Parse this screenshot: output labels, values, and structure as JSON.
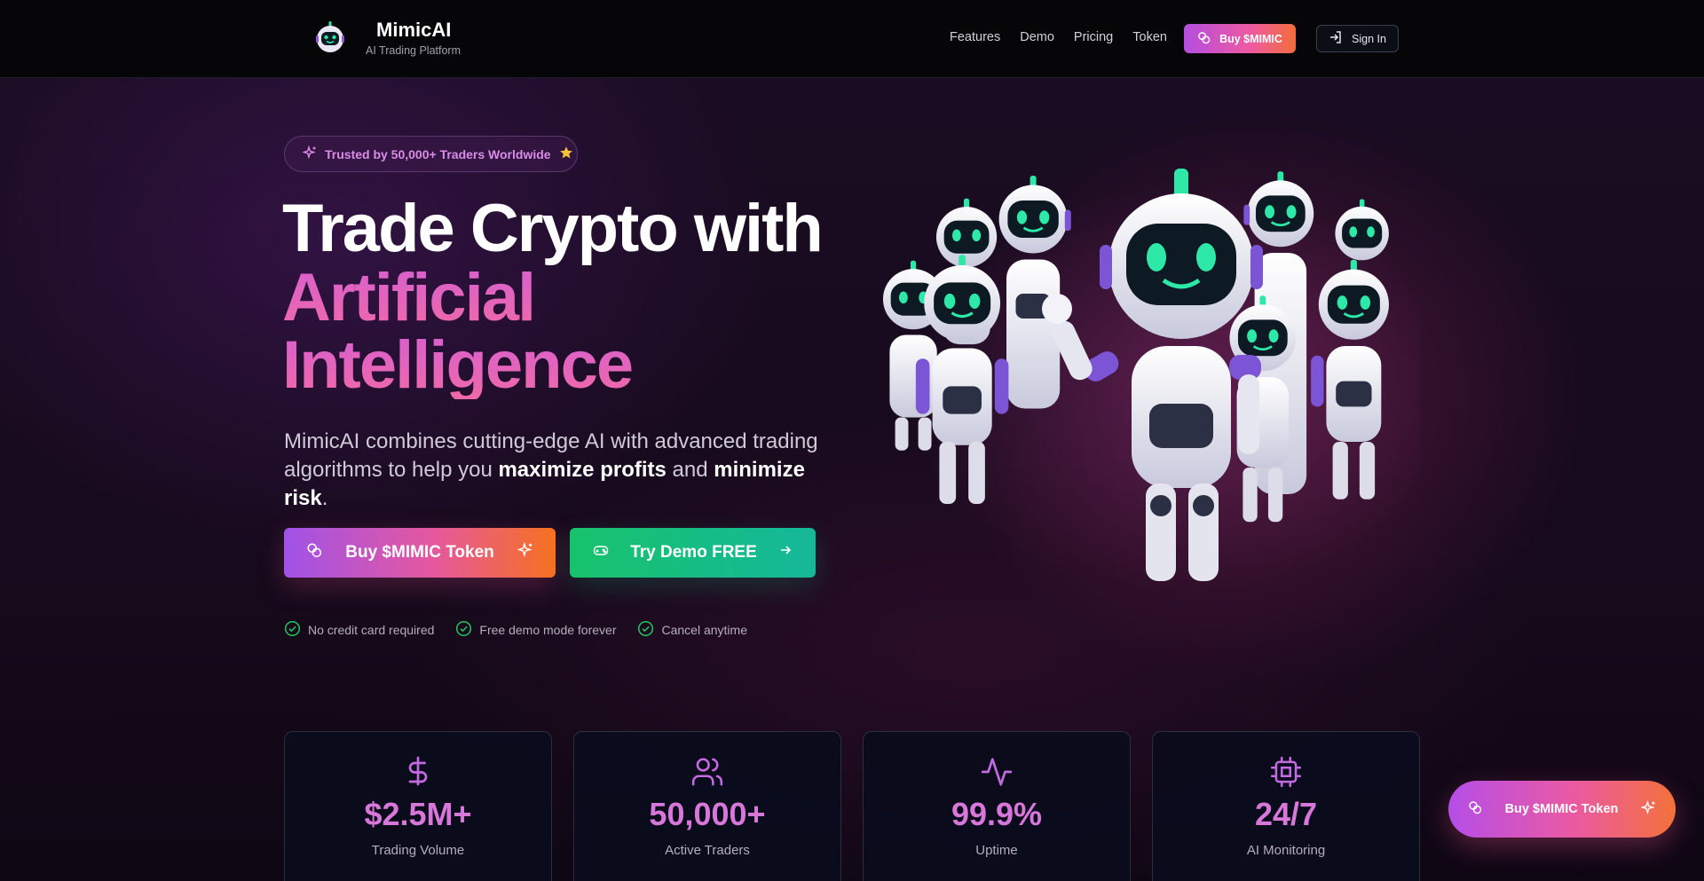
{
  "brand": {
    "name": "MimicAI",
    "subtitle": "AI Trading Platform"
  },
  "nav": {
    "links": [
      "Features",
      "Demo",
      "Pricing",
      "Token"
    ],
    "buy_label": "Buy $MIMIC",
    "signin_label": "Sign In"
  },
  "hero": {
    "badge": "Trusted by 50,000+ Traders Worldwide",
    "headline_line1": "Trade Crypto with",
    "headline_line2": "Artificial",
    "headline_line3": "Intelligence",
    "lead_part1": "MimicAI combines cutting-edge AI with advanced trading algorithms to help you ",
    "lead_bold1": "maximize profits",
    "lead_part2": " and ",
    "lead_bold2": "minimize risk",
    "lead_part3": ".",
    "cta_buy": "Buy $MIMIC Token",
    "cta_demo": "Try Demo FREE",
    "checks": [
      "No credit card required",
      "Free demo mode forever",
      "Cancel anytime"
    ]
  },
  "stats": [
    {
      "icon": "dollar-icon",
      "value": "$2.5M+",
      "label": "Trading Volume"
    },
    {
      "icon": "users-icon",
      "value": "50,000+",
      "label": "Active Traders"
    },
    {
      "icon": "activity-icon",
      "value": "99.9%",
      "label": "Uptime"
    },
    {
      "icon": "cpu-icon",
      "value": "24/7",
      "label": "AI Monitoring"
    }
  ],
  "floating_buy": "Buy $MIMIC Token",
  "colors": {
    "accent_pink": "#e05fb4",
    "accent_purple": "#a052e8",
    "accent_orange": "#f6711f",
    "accent_green": "#17c26b",
    "robot_eyes": "#2ee8a8"
  }
}
